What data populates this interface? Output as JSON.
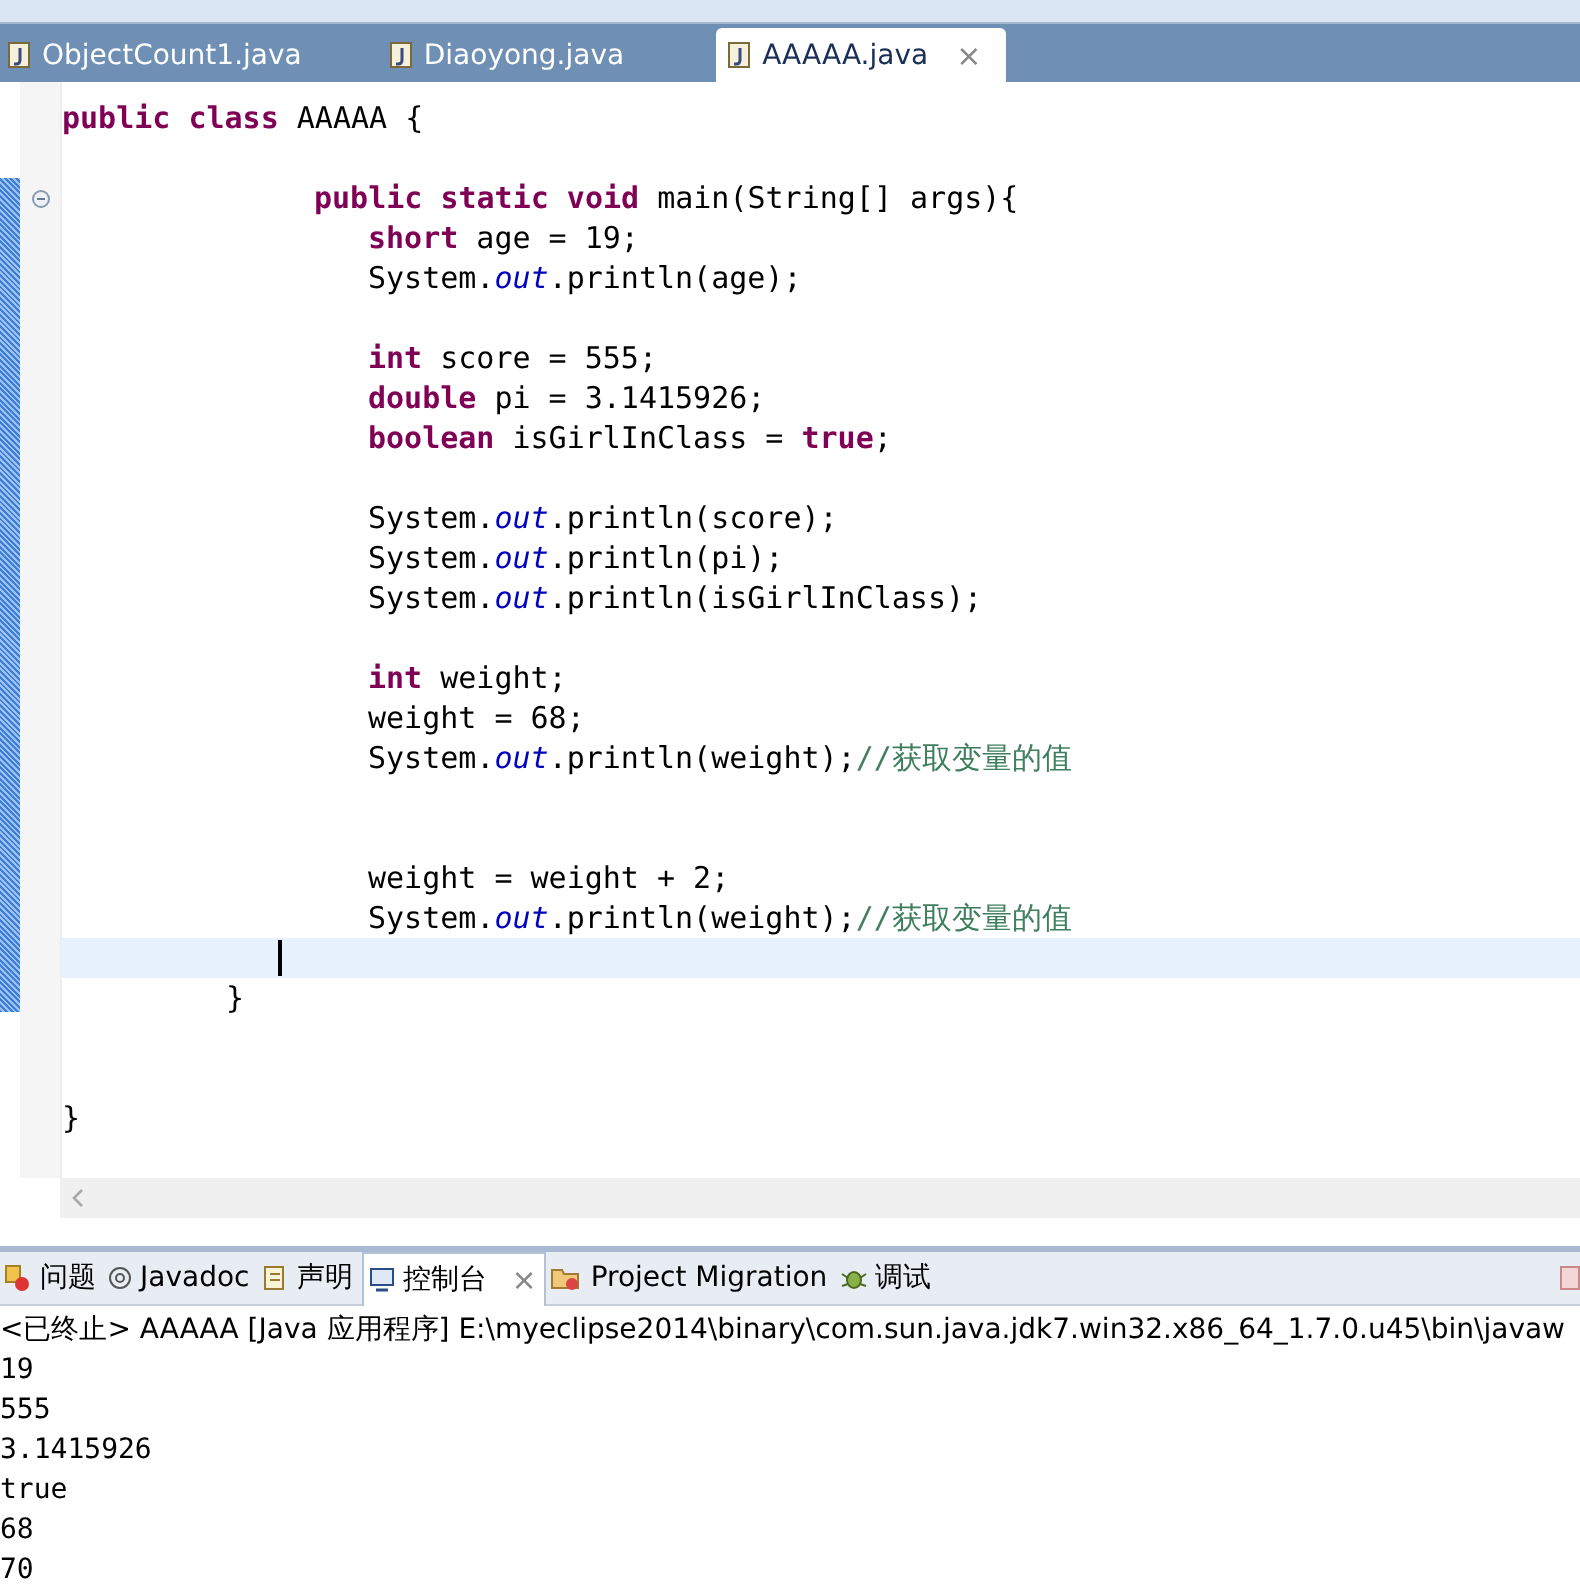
{
  "editor_tabs": [
    {
      "label": "ObjectCount1.java",
      "selected": false
    },
    {
      "label": "Diaoyong.java",
      "selected": false
    },
    {
      "label": "AAAAA.java",
      "selected": true,
      "close": "×"
    }
  ],
  "code_lines": [
    {
      "kind": "class",
      "tokens": [
        {
          "kind": "kw",
          "text": "public class"
        },
        {
          "kind": "plain",
          "text": " AAAAA {"
        }
      ]
    },
    {
      "kind": "method",
      "blank_before": true,
      "fold": true,
      "tokens": [
        {
          "kind": "kw",
          "text": "public static void"
        },
        {
          "kind": "plain",
          "text": " main(String[] args){"
        }
      ]
    },
    {
      "kind": "body",
      "tokens": [
        {
          "kind": "kw",
          "text": "short"
        },
        {
          "kind": "plain",
          "text": " age = 19;"
        }
      ]
    },
    {
      "kind": "body",
      "tokens": [
        {
          "kind": "plain",
          "text": "System."
        },
        {
          "kind": "field",
          "text": "out"
        },
        {
          "kind": "plain",
          "text": ".println(age);"
        }
      ]
    },
    {
      "kind": "body",
      "blank_before": true,
      "tokens": [
        {
          "kind": "kw",
          "text": "int"
        },
        {
          "kind": "plain",
          "text": " score = 555;"
        }
      ]
    },
    {
      "kind": "body",
      "tokens": [
        {
          "kind": "kw",
          "text": "double"
        },
        {
          "kind": "plain",
          "text": " pi = 3.1415926;"
        }
      ]
    },
    {
      "kind": "body",
      "tokens": [
        {
          "kind": "kw",
          "text": "boolean"
        },
        {
          "kind": "plain",
          "text": " isGirlInClass = "
        },
        {
          "kind": "kw",
          "text": "true"
        },
        {
          "kind": "plain",
          "text": ";"
        }
      ]
    },
    {
      "kind": "body",
      "blank_before": true,
      "tokens": [
        {
          "kind": "plain",
          "text": "System."
        },
        {
          "kind": "field",
          "text": "out"
        },
        {
          "kind": "plain",
          "text": ".println(score);"
        }
      ]
    },
    {
      "kind": "body",
      "tokens": [
        {
          "kind": "plain",
          "text": "System."
        },
        {
          "kind": "field",
          "text": "out"
        },
        {
          "kind": "plain",
          "text": ".println(pi);"
        }
      ]
    },
    {
      "kind": "body",
      "tokens": [
        {
          "kind": "plain",
          "text": "System."
        },
        {
          "kind": "field",
          "text": "out"
        },
        {
          "kind": "plain",
          "text": ".println(isGirlInClass);"
        }
      ]
    },
    {
      "kind": "body",
      "blank_before": true,
      "tokens": [
        {
          "kind": "kw",
          "text": "int"
        },
        {
          "kind": "plain",
          "text": " weight;"
        }
      ]
    },
    {
      "kind": "body",
      "tokens": [
        {
          "kind": "plain",
          "text": "weight = 68;"
        }
      ]
    },
    {
      "kind": "body",
      "tokens": [
        {
          "kind": "plain",
          "text": "System."
        },
        {
          "kind": "field",
          "text": "out"
        },
        {
          "kind": "plain",
          "text": ".println(weight);"
        },
        {
          "kind": "comment",
          "text": "//获取变量的值"
        }
      ]
    },
    {
      "kind": "body",
      "blank_before": true,
      "double_blank": true,
      "tokens": [
        {
          "kind": "plain",
          "text": "weight = weight + 2;"
        }
      ]
    },
    {
      "kind": "body",
      "tokens": [
        {
          "kind": "plain",
          "text": "System."
        },
        {
          "kind": "field",
          "text": "out"
        },
        {
          "kind": "plain",
          "text": ".println(weight);"
        },
        {
          "kind": "comment",
          "text": "//获取变量的值"
        }
      ]
    },
    {
      "current": true
    },
    {
      "kind": "method_close",
      "tokens": [
        {
          "kind": "plain",
          "text": "}"
        }
      ]
    },
    {
      "kind": "class",
      "blank_before": true,
      "double_blank": true,
      "tokens": [
        {
          "kind": "plain",
          "text": "}"
        }
      ]
    }
  ],
  "view_tabs": [
    {
      "label": "问题",
      "kind": "problems",
      "selected": false
    },
    {
      "label": "Javadoc",
      "kind": "javadoc",
      "selected": false
    },
    {
      "label": "声明",
      "kind": "declaration",
      "selected": false
    },
    {
      "label": "控制台",
      "kind": "console",
      "selected": true,
      "close": "×"
    },
    {
      "label": "Project Migration",
      "kind": "migration",
      "selected": false
    },
    {
      "label": "调试",
      "kind": "debug",
      "selected": false
    }
  ],
  "console": {
    "header": "<已终止> AAAAA [Java 应用程序] E:\\myeclipse2014\\binary\\com.sun.java.jdk7.win32.x86_64_1.7.0.u45\\bin\\javaw",
    "output": [
      "19",
      "555",
      "3.1415926",
      "true",
      "68",
      "70"
    ]
  }
}
